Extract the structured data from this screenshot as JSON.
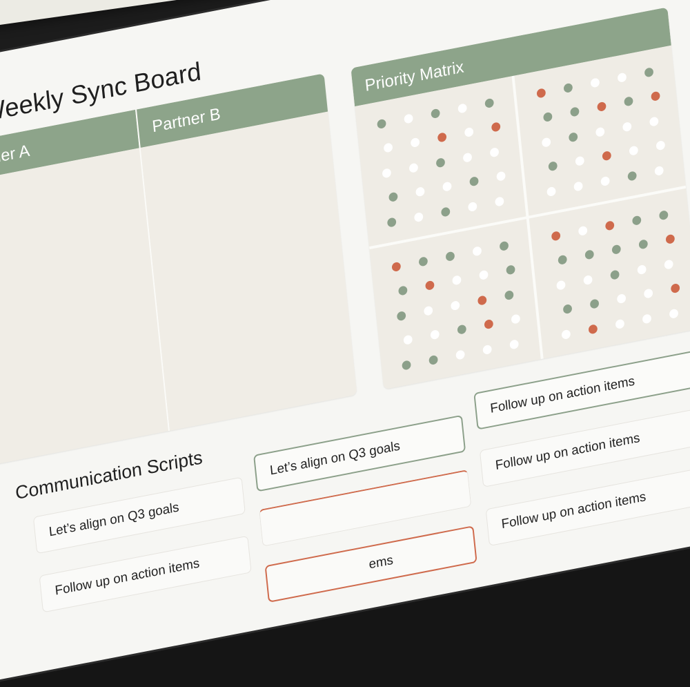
{
  "board": {
    "title": "Weekly Sync Board",
    "partners": [
      {
        "label": "Partner A"
      },
      {
        "label": "Partner B"
      }
    ]
  },
  "priority_matrix": {
    "title": "Priority Matrix",
    "colors": {
      "green": "#8ca08a",
      "white": "#ffffff",
      "orange": "#cf6a4c"
    },
    "quadrants": [
      {
        "dots": [
          "g",
          "w",
          "g",
          "w",
          "g",
          "w",
          "w",
          "o",
          "w",
          "o",
          "w",
          "w",
          "g",
          "w",
          "w",
          "g",
          "w",
          "w",
          "g",
          "w",
          "g",
          "w",
          "g",
          "w",
          "w"
        ]
      },
      {
        "dots": [
          "o",
          "g",
          "w",
          "w",
          "g",
          "g",
          "g",
          "o",
          "g",
          "o",
          "w",
          "g",
          "w",
          "w",
          "w",
          "g",
          "w",
          "o",
          "w",
          "w",
          "w",
          "w",
          "w",
          "g",
          "w"
        ]
      },
      {
        "dots": [
          "o",
          "g",
          "g",
          "w",
          "g",
          "g",
          "o",
          "w",
          "w",
          "g",
          "g",
          "w",
          "w",
          "o",
          "g",
          "w",
          "w",
          "g",
          "o",
          "w",
          "g",
          "g",
          "w",
          "w",
          "w"
        ]
      },
      {
        "dots": [
          "o",
          "w",
          "o",
          "g",
          "g",
          "g",
          "g",
          "g",
          "g",
          "o",
          "w",
          "w",
          "g",
          "w",
          "w",
          "g",
          "g",
          "w",
          "w",
          "o",
          "w",
          "o",
          "w",
          "w",
          "w"
        ]
      }
    ]
  },
  "communication_scripts": {
    "title": "Communication Scripts",
    "cards": [
      {
        "text": "Let’s align on Q3 goals"
      },
      {
        "text": "Let’s align on Q3 goals"
      },
      {
        "text": "Follow up on action items"
      },
      {
        "text": ""
      },
      {
        "text": "Follow up on action items"
      },
      {
        "text": "Follow up on action items"
      },
      {
        "text": "ems"
      },
      {
        "text": "Follow up on action items"
      }
    ]
  }
}
